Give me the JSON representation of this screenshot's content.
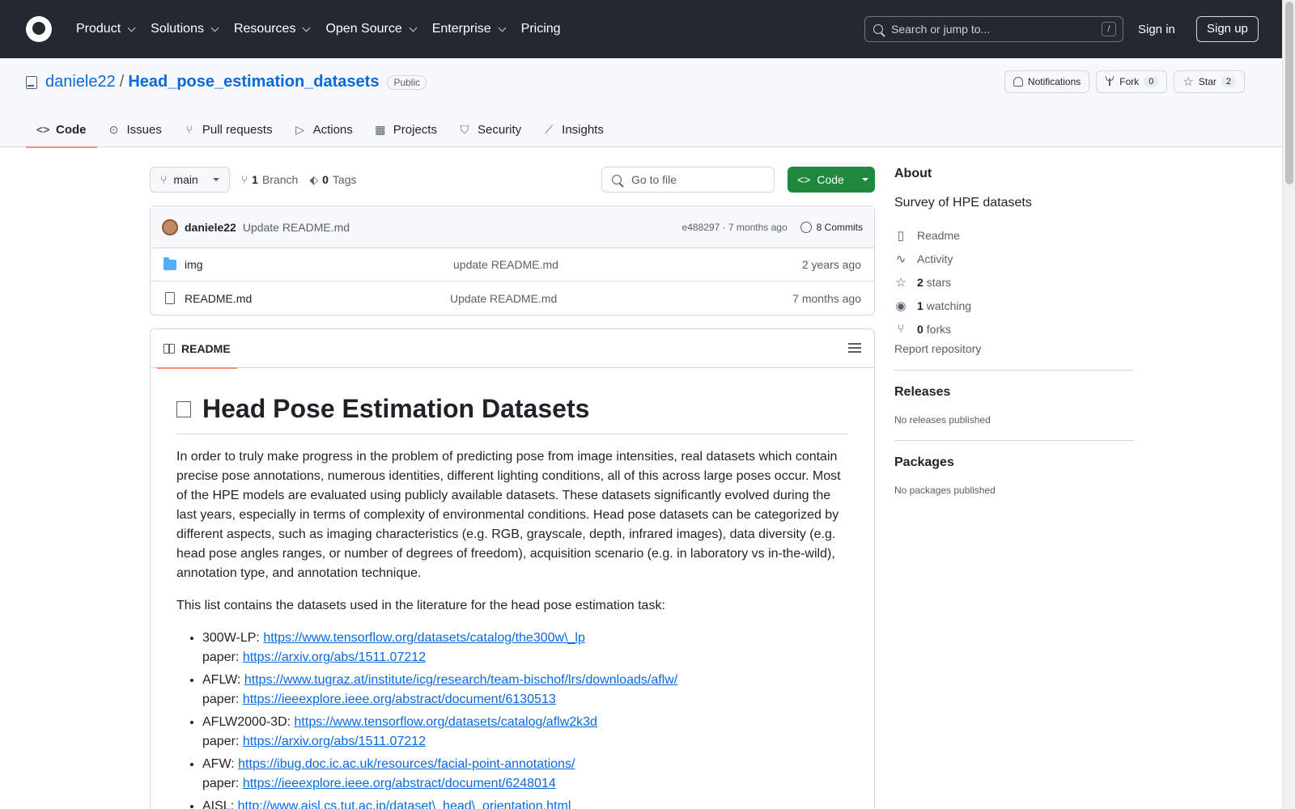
{
  "header": {
    "nav": [
      "Product",
      "Solutions",
      "Resources",
      "Open Source",
      "Enterprise",
      "Pricing"
    ],
    "search_placeholder": "Search or jump to...",
    "search_shortcut": "/",
    "signin": "Sign in",
    "signup": "Sign up"
  },
  "repo": {
    "owner": "daniele22",
    "separator": "/",
    "name": "Head_pose_estimation_datasets",
    "visibility": "Public",
    "notifications_label": "Notifications",
    "fork_label": "Fork",
    "fork_count": "0",
    "star_label": "Star",
    "star_count": "2"
  },
  "tabs": [
    {
      "label": "Code",
      "icon": "code-icon"
    },
    {
      "label": "Issues",
      "icon": "issue-icon"
    },
    {
      "label": "Pull requests",
      "icon": "pull-request-icon"
    },
    {
      "label": "Actions",
      "icon": "play-icon"
    },
    {
      "label": "Projects",
      "icon": "table-icon"
    },
    {
      "label": "Security",
      "icon": "shield-icon"
    },
    {
      "label": "Insights",
      "icon": "graph-icon"
    }
  ],
  "toolbar": {
    "branch": "main",
    "branch_count": "1",
    "branch_label": "Branch",
    "tag_count": "0",
    "tag_label": "Tags",
    "goto_placeholder": "Go to file",
    "code_button": "Code"
  },
  "commit": {
    "author": "daniele22",
    "message": "Update README.md",
    "meta": "e488297 · 7 months ago",
    "commits_label": "8 Commits"
  },
  "files": [
    {
      "name": "img",
      "type": "folder",
      "message": "update README.md",
      "date": "2 years ago"
    },
    {
      "name": "README.md",
      "type": "file",
      "message": "Update README.md",
      "date": "7 months ago"
    }
  ],
  "readme": {
    "tab_label": "README",
    "title": "Head Pose Estimation Datasets",
    "intro": "In order to truly make progress in the problem of predicting pose from image intensities, real datasets which contain precise pose annotations, numerous identities, different lighting conditions, all of this across large poses occur. Most of the HPE models are evaluated using publicly available datasets. These datasets significantly evolved during the last years, especially in terms of complexity of environmental conditions. Head pose datasets can be categorized by different aspects, such as imaging characteristics (e.g. RGB, grayscale, depth, infrared images), data diversity (e.g. head pose angles ranges, or number of degrees of freedom), acquisition scenario (e.g. in laboratory vs in-the-wild), annotation type, and annotation technique.",
    "list_intro": "This list contains the datasets used in the literature for the head pose estimation task:",
    "paper_label": "paper:",
    "datasets": [
      {
        "name": "300W-LP:",
        "url": "https://www.tensorflow.org/datasets/catalog/the300w\\_lp",
        "paper": "https://arxiv.org/abs/1511.07212"
      },
      {
        "name": "AFLW:",
        "url": "https://www.tugraz.at/institute/icg/research/team-bischof/lrs/downloads/aflw/",
        "paper": "https://ieeexplore.ieee.org/abstract/document/6130513"
      },
      {
        "name": "AFLW2000-3D:",
        "url": "https://www.tensorflow.org/datasets/catalog/aflw2k3d",
        "paper": "https://arxiv.org/abs/1511.07212"
      },
      {
        "name": "AFW:",
        "url": "https://ibug.doc.ic.ac.uk/resources/facial-point-annotations/",
        "paper": "https://ieeexplore.ieee.org/abstract/document/6248014"
      },
      {
        "name": "AISL:",
        "url": "http://www.aisl.cs.tut.ac.jp/dataset\\_head\\_orientation.html",
        "paper": ""
      }
    ]
  },
  "about": {
    "heading": "About",
    "description": "Survey of HPE datasets",
    "items": [
      {
        "icon": "book-icon",
        "count": "",
        "label": "Readme"
      },
      {
        "icon": "pulse-icon",
        "count": "",
        "label": "Activity"
      },
      {
        "icon": "star-icon",
        "count": "2",
        "label": "stars"
      },
      {
        "icon": "eye-icon",
        "count": "1",
        "label": "watching"
      },
      {
        "icon": "fork-icon",
        "count": "0",
        "label": "forks"
      }
    ],
    "report": "Report repository"
  },
  "releases": {
    "heading": "Releases",
    "note": "No releases published"
  },
  "packages": {
    "heading": "Packages",
    "note": "No packages published"
  }
}
